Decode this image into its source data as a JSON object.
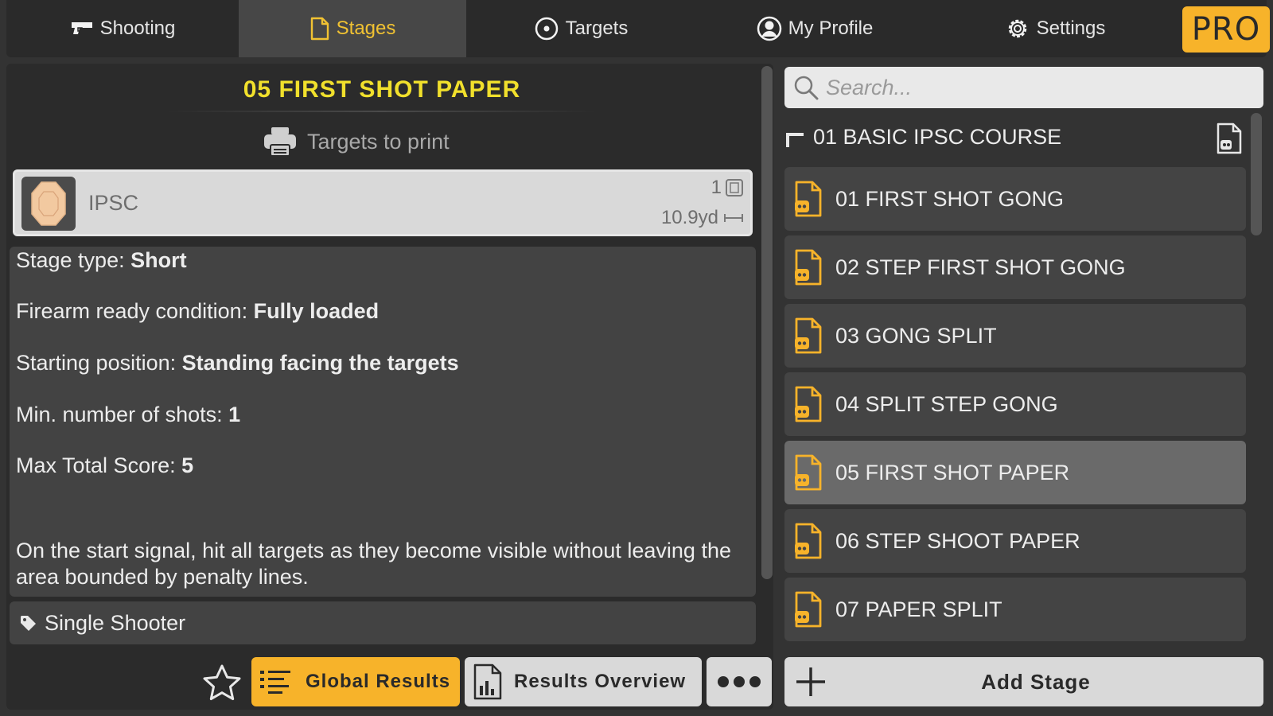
{
  "nav": {
    "tabs": [
      {
        "label": "Shooting",
        "icon": "pistol-icon"
      },
      {
        "label": "Stages",
        "icon": "document-icon",
        "active": true
      },
      {
        "label": "Targets",
        "icon": "target-icon"
      },
      {
        "label": "My Profile",
        "icon": "user-icon"
      },
      {
        "label": "Settings",
        "icon": "gear-icon"
      }
    ],
    "pro_label": "PRO"
  },
  "stage": {
    "title": "05 FIRST SHOT PAPER",
    "print_label": "Targets to print",
    "target": {
      "name": "IPSC",
      "count": "1",
      "distance": "10.9yd"
    },
    "type_label": "Stage type:",
    "type_value": "Short",
    "ready_label": "Firearm ready condition:",
    "ready_value": "Fully loaded",
    "position_label": "Starting position:",
    "position_value": "Standing facing the targets",
    "min_shots_label": "Min. number of shots:",
    "min_shots_value": "1",
    "max_score_label": "Max Total Score:",
    "max_score_value": "5",
    "description": "On the start signal, hit all targets as they become visible without leaving the area bounded by penalty lines.",
    "tag": "Single Shooter"
  },
  "actions": {
    "global_results": "Global Results",
    "results_overview": "Results Overview"
  },
  "sidebar": {
    "search_placeholder": "Search...",
    "course": "01 BASIC IPSC COURSE",
    "stages": [
      {
        "label": "01 FIRST SHOT GONG"
      },
      {
        "label": "02 STEP FIRST SHOT GONG"
      },
      {
        "label": "03 GONG SPLIT"
      },
      {
        "label": "04 SPLIT STEP GONG"
      },
      {
        "label": "05 FIRST SHOT PAPER",
        "active": true
      },
      {
        "label": "06 STEP SHOOT PAPER"
      },
      {
        "label": "07 PAPER SPLIT"
      }
    ],
    "add_stage": "Add Stage"
  },
  "colors": {
    "accent": "#f7b32a",
    "title_yellow": "#f1e02c",
    "background": "#333333",
    "panel": "#2b2b2b",
    "card": "#444444"
  }
}
